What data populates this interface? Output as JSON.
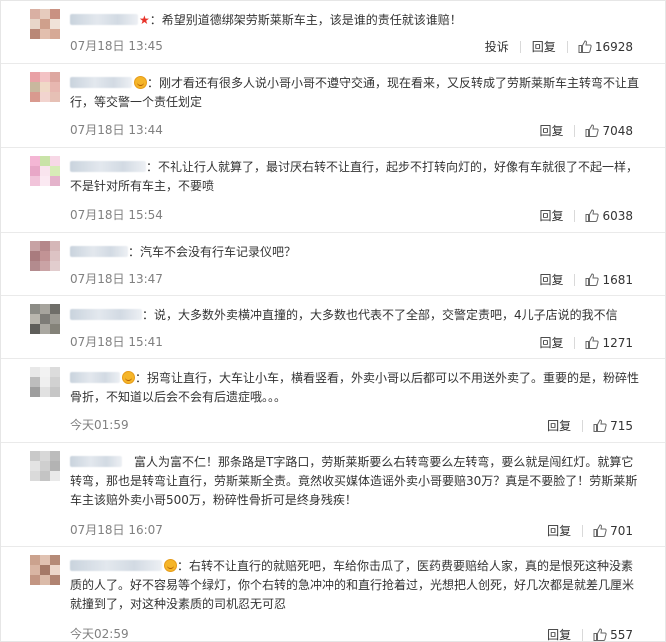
{
  "comments": [
    {
      "text": "希望别道德绑架劳斯莱斯车主，该是谁的责任就该谁赔！",
      "time": "07月18日 13:45",
      "report": "投诉",
      "reply": "回复",
      "likes": "16928",
      "badge": "star"
    },
    {
      "text": "刚才看还有很多人说小哥小哥不遵守交通，现在看来，又反转成了劳斯莱斯车主转弯不让直行，等交警一个责任划定",
      "time": "07月18日 13:44",
      "reply": "回复",
      "likes": "7048",
      "badge": "smile"
    },
    {
      "text": "不礼让行人就算了，最讨厌右转不让直行，起步不打转向灯的，好像有车就很了不起一样，不是针对所有车主，不要喷",
      "time": "07月18日 15:54",
      "reply": "回复",
      "likes": "6038",
      "badge": ""
    },
    {
      "text": "汽车不会没有行车记录仪吧？",
      "time": "07月18日 13:47",
      "reply": "回复",
      "likes": "1681",
      "badge": ""
    },
    {
      "text": "说，大多数外卖横冲直撞的，大多数也代表不了全部，交警定责吧，4儿子店说的我不信",
      "time": "07月18日 15:41",
      "reply": "回复",
      "likes": "1271",
      "badge": ""
    },
    {
      "text": "拐弯让直行，大车让小车，横看竖看，外卖小哥以后都可以不用送外卖了。重要的是，粉碎性骨折，不知道以后会不会有后遗症哦。。。",
      "time": "今天01:59",
      "reply": "回复",
      "likes": "715",
      "badge": "smile"
    },
    {
      "text": "富人为富不仁！那条路是T字路口，劳斯莱斯要么右转弯要么左转弯，要么就是闯红灯。就算它转弯，那也是转弯让直行，劳斯莱斯全责。竟然收买媒体造谣外卖小哥要赔30万？真是不要脸了！劳斯莱斯车主该赔外卖小哥500万，粉碎性骨折可是终身残疾！",
      "time": "07月18日 16:07",
      "reply": "回复",
      "likes": "701",
      "badge": ""
    },
    {
      "text": "右转不让直行的就赔死吧，车给你击瓜了，医药费要赔给人家，真的是恨死这种没素质的人了。好不容易等个绿灯，你个右转的急冲冲的和直行抢着过，光想把人创死，好几次都是就差几厘米就撞到了，对这种没素质的司机忍无可忍",
      "time": "今天02:59",
      "reply": "回复",
      "likes": "557",
      "badge": "smile"
    }
  ]
}
